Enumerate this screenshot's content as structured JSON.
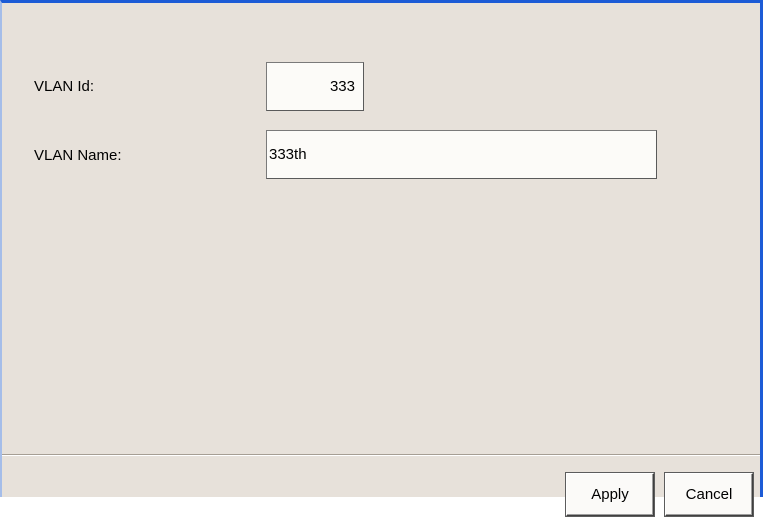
{
  "form": {
    "vlan_id": {
      "label": "VLAN Id:",
      "value": "333"
    },
    "vlan_name": {
      "label": "VLAN Name:",
      "value": "333th"
    }
  },
  "buttons": {
    "apply_label": "Apply",
    "cancel_label": "Cancel"
  },
  "colors": {
    "window_border": "#1c5bd6",
    "panel_background": "#e7e1da",
    "field_background": "#fcfbf8"
  }
}
